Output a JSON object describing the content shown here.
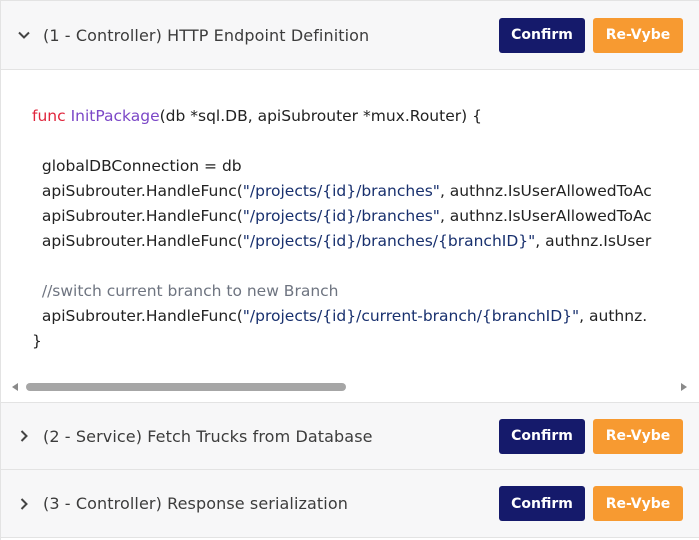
{
  "sections": [
    {
      "title": "(1 - Controller) HTTP Endpoint Definition",
      "expanded": true
    },
    {
      "title": "(2 - Service) Fetch Trucks from Database",
      "expanded": false
    },
    {
      "title": "(3 - Controller) Response serialization",
      "expanded": false
    }
  ],
  "buttons": {
    "confirm": "Confirm",
    "revybe": "Re-Vybe"
  },
  "code": {
    "l1_kw": "func",
    "l1_fn": "InitPackage",
    "l1_rest": "(db *sql.DB, apiSubrouter *mux.Router) {",
    "l3": "globalDBConnection = db",
    "l4_pre": "apiSubrouter.HandleFunc(",
    "l4_str": "\"/projects/{id}/branches\"",
    "l4_post": ", authnz.IsUserAllowedToAc",
    "l5_pre": "apiSubrouter.HandleFunc(",
    "l5_str": "\"/projects/{id}/branches\"",
    "l5_post": ", authnz.IsUserAllowedToAc",
    "l6_pre": "apiSubrouter.HandleFunc(",
    "l6_str": "\"/projects/{id}/branches/{branchID}\"",
    "l6_post": ", authnz.IsUser",
    "l8": "//switch current branch to new Branch",
    "l9_pre": "apiSubrouter.HandleFunc(",
    "l9_str": "\"/projects/{id}/current-branch/{branchID}\"",
    "l9_post": ", authnz.",
    "l10": "}"
  },
  "colors": {
    "confirm_bg": "#151a6b",
    "revybe_bg": "#f79a31",
    "keyword": "#e0263d",
    "function_name": "#7b47c7",
    "string": "#18306e",
    "comment": "#6e7480"
  },
  "icons": {
    "expanded": "chevron-down-icon",
    "collapsed": "chevron-right-icon"
  }
}
